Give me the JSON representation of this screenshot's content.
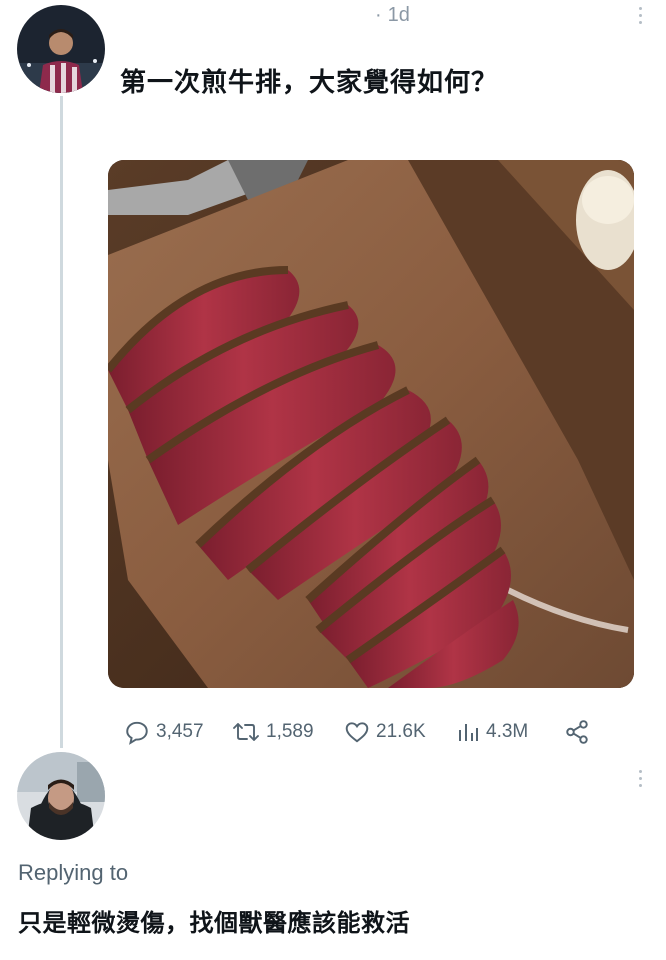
{
  "tweet": {
    "timestamp": "1d",
    "text": "第一次煎牛排，大家覺得如何？",
    "media_subject": "sliced-steak-photo",
    "stats": {
      "replies": "3,457",
      "retweets": "1,589",
      "likes": "21.6K",
      "views": "4.3M"
    }
  },
  "reply": {
    "replying_to_label": "Replying to",
    "text": "只是輕微燙傷，找個獸醫應該能救活"
  },
  "colors": {
    "muted_text": "#536471",
    "thread_line": "#cfd9de",
    "primary_text": "#0f1419"
  },
  "icons": {
    "reply": "reply-icon",
    "retweet": "retweet-icon",
    "like": "heart-icon",
    "views": "views-icon",
    "share": "share-icon",
    "more": "more-icon"
  }
}
